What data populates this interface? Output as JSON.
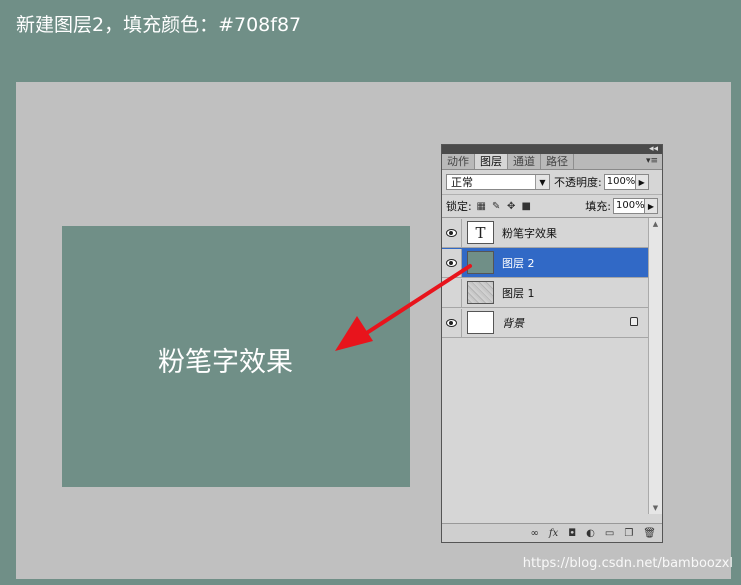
{
  "header": {
    "text": "新建图层2，填充颜色：#708f87"
  },
  "canvas": {
    "swatch_color": "#708f87",
    "swatch_text": "粉笔字效果",
    "arrow_color": "#e8141c"
  },
  "layers_panel": {
    "tabs": [
      {
        "label": "动作",
        "active": false
      },
      {
        "label": "图层",
        "active": true
      },
      {
        "label": "通道",
        "active": false
      },
      {
        "label": "路径",
        "active": false
      }
    ],
    "blend_mode": "正常",
    "opacity_label": "不透明度:",
    "opacity_value": "100%",
    "lock_label": "锁定:",
    "fill_label": "填充:",
    "fill_value": "100%",
    "layers": [
      {
        "name": "粉笔字效果",
        "visible": true,
        "thumb": "T",
        "selected": false
      },
      {
        "name": "图层 2",
        "visible": true,
        "thumb": "",
        "selected": true
      },
      {
        "name": "图层 1",
        "visible": false,
        "thumb": "",
        "selected": false
      },
      {
        "name": "背景",
        "visible": true,
        "thumb": "",
        "selected": false,
        "locked": true
      }
    ]
  },
  "watermark": "https://blog.csdn.net/bamboozxl"
}
